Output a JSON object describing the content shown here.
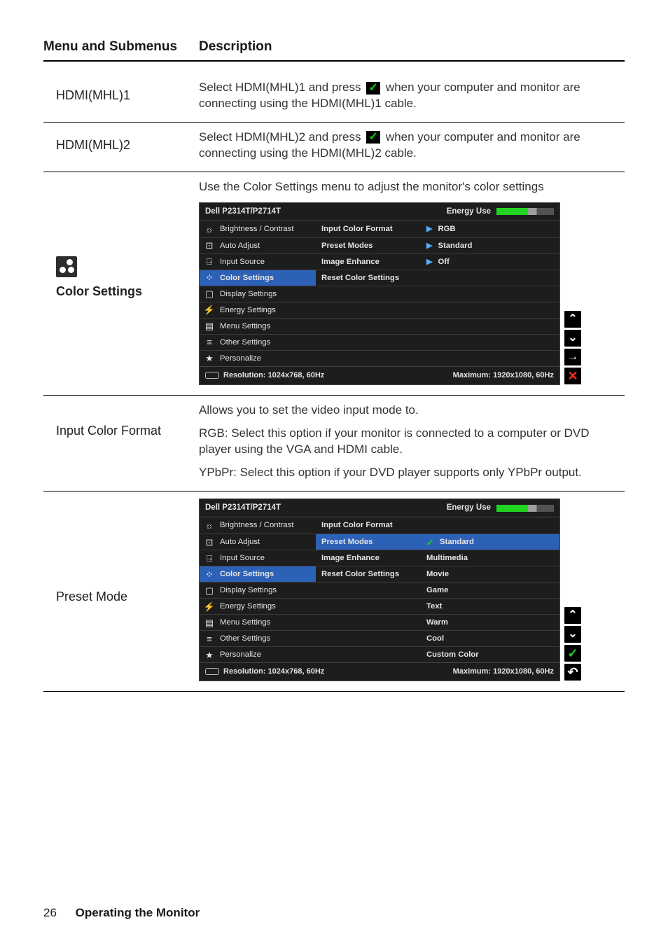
{
  "header": {
    "col1": "Menu and Submenus",
    "col2": "Description"
  },
  "rows": {
    "hdmi1": {
      "label": "HDMI(MHL)1",
      "desc_a": "Select HDMI(MHL)1 and press ",
      "desc_b": " when your computer and monitor are connecting using the HDMI(MHL)1 cable."
    },
    "hdmi2": {
      "label": "HDMI(MHL)2",
      "desc_a": "Select HDMI(MHL)2 and press ",
      "desc_b": " when your computer and monitor are connecting using the HDMI(MHL)2 cable."
    },
    "color": {
      "label": "Color Settings",
      "desc": "Use the Color Settings menu to adjust the monitor's color settings"
    },
    "icf": {
      "label": "Input Color Format",
      "p1": "Allows you to set the video input mode to.",
      "p2": "RGB: Select this option if your monitor is connected to a computer or DVD player using the VGA and HDMI cable.",
      "p3": "YPbPr: Select this option if your DVD player supports only YPbPr output."
    },
    "preset": {
      "label": "Preset Mode"
    }
  },
  "osd": {
    "model": "Dell P2314T/P2714T",
    "energy_label": "Energy Use",
    "menu": [
      "Brightness / Contrast",
      "Auto Adjust",
      "Input Source",
      "Color Settings",
      "Display Settings",
      "Energy Settings",
      "Menu Settings",
      "Other Settings",
      "Personalize"
    ],
    "sub": [
      "Input Color Format",
      "Preset Modes",
      "Image Enhance",
      "Reset Color Settings"
    ],
    "vals1": [
      "RGB",
      "Standard",
      "Off"
    ],
    "vals2": [
      "Standard",
      "Multimedia",
      "Movie",
      "Game",
      "Text",
      "Warm",
      "Cool",
      "Custom Color"
    ],
    "res_label": "Resolution:",
    "res_val": "1024x768, 60Hz",
    "max_label": "Maximum:",
    "max_val": "1920x1080, 60Hz"
  },
  "icons": {
    "brightness": "☼",
    "auto": "⊡",
    "input": "⍈",
    "color": "⁘",
    "display": "▢",
    "energy": "⚡",
    "menu": "▤",
    "other": "≡",
    "personalize": "★"
  },
  "nav": {
    "up": "⌃",
    "down": "⌄",
    "right": "→",
    "x": "✕",
    "check": "✓",
    "back": "↶"
  },
  "footer": {
    "page": "26",
    "title": "Operating the Monitor"
  }
}
